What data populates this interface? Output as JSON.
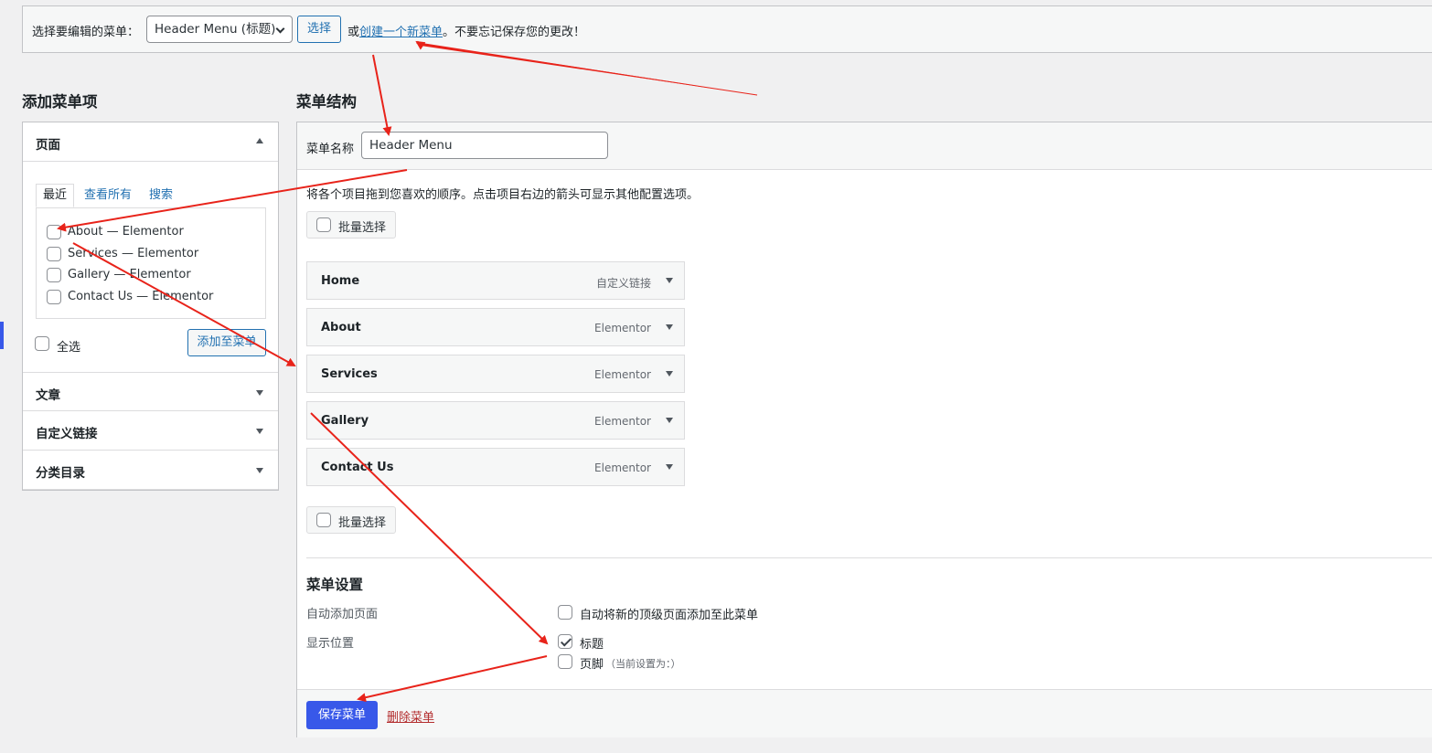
{
  "select_bar": {
    "label": "选择要编辑的菜单：",
    "selected_menu": "Header Menu (标题)",
    "select_button": "选择",
    "or_text": "或",
    "create_link": "创建一个新菜单",
    "reminder": "。不要忘记保存您的更改！"
  },
  "add_items": {
    "heading": "添加菜单项",
    "pages": {
      "title": "页面",
      "tabs": [
        "最近",
        "查看所有",
        "搜索"
      ],
      "items": [
        {
          "label": "About — Elementor",
          "checked": false
        },
        {
          "label": "Services — Elementor",
          "checked": false
        },
        {
          "label": "Gallery — Elementor",
          "checked": false
        },
        {
          "label": "Contact Us — Elementor",
          "checked": false
        }
      ],
      "select_all": "全选",
      "add_button": "添加至菜单"
    },
    "posts_title": "文章",
    "custom_links_title": "自定义链接",
    "categories_title": "分类目录"
  },
  "structure": {
    "heading": "菜单结构",
    "name_label": "菜单名称",
    "name_value": "Header Menu",
    "instructions": "将各个项目拖到您喜欢的顺序。点击项目右边的箭头可显示其他配置选项。",
    "bulk_select": "批量选择",
    "menu_items": [
      {
        "title": "Home",
        "type": "自定义链接"
      },
      {
        "title": "About",
        "type": "Elementor"
      },
      {
        "title": "Services",
        "type": "Elementor"
      },
      {
        "title": "Gallery",
        "type": "Elementor"
      },
      {
        "title": "Contact Us",
        "type": "Elementor"
      }
    ]
  },
  "settings": {
    "heading": "菜单设置",
    "auto_add_label": "自动添加页面",
    "auto_add_option": "自动将新的顶级页面添加至此菜单",
    "auto_add_checked": false,
    "location_label": "显示位置",
    "locations": [
      {
        "label": "标题",
        "note": "",
        "checked": true
      },
      {
        "label": "页脚",
        "note": "（当前设置为：）",
        "checked": false
      }
    ]
  },
  "footer": {
    "save_button": "保存菜单",
    "delete_link": "删除菜单"
  },
  "colors": {
    "primary": "#3858e9",
    "link": "#2271b1",
    "danger": "#b32d2e",
    "annotation_arrow": "#e8231a"
  }
}
